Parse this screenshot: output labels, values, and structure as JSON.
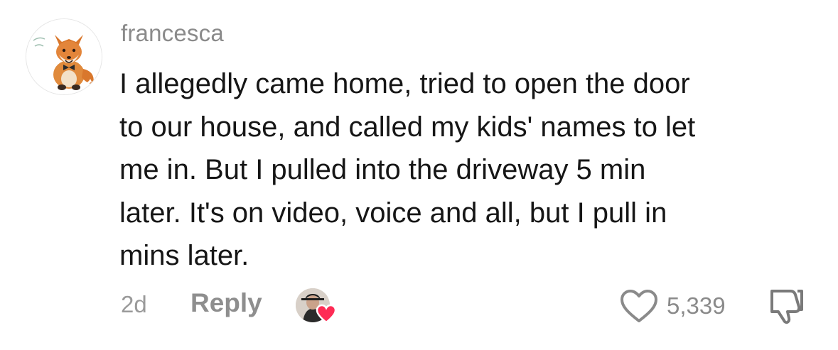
{
  "comment": {
    "username": "francesca",
    "text": "I allegedly came home, tried to open the door\nto our house, and called my kids' names to let\nme in. But I pulled into the driveway 5 min\nlater. It's on video, voice and all, but I pull in\nmins later.",
    "time_ago": "2d",
    "reply_label": "Reply",
    "like_count": "5,339"
  },
  "icons": {
    "avatar": "fox-avatar",
    "liked_by_creator": "creator-avatar-with-heart",
    "like": "heart-outline-icon",
    "dislike": "thumbs-down-icon"
  },
  "colors": {
    "username": "#8a8a8a",
    "text": "#161616",
    "meta": "#8e8e8e",
    "heart_accent": "#fe2c55"
  }
}
